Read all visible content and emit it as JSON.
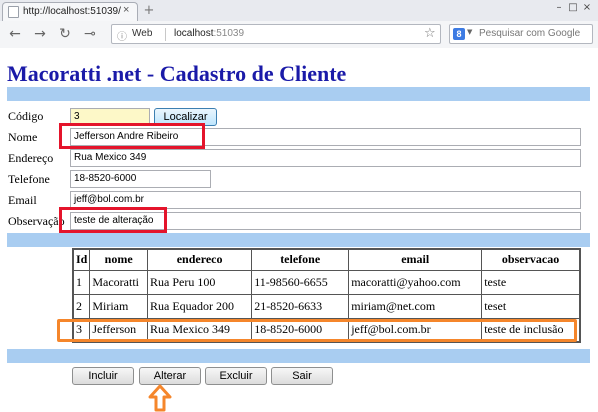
{
  "browser": {
    "tab_title": "http://localhost:51039/",
    "tab_close": "×",
    "new_tab": "+",
    "win_controls": [
      "–",
      "□",
      "×"
    ],
    "back_icon": "←",
    "forward_icon": "→",
    "reload_icon": "↻",
    "key_icon": "⊸",
    "omnibox_info_icon": "ⓘ",
    "omnibox_web": "Web",
    "url_host": "localhost",
    "url_port": ":51039",
    "star_icon": "☆",
    "search_engine_letter": "8",
    "search_drop_icon": "▼",
    "search_placeholder": "Pesquisar com Google"
  },
  "page": {
    "title": "Macoratti .net - Cadastro de Cliente"
  },
  "form": {
    "codigo": {
      "label": "Código",
      "value": "3"
    },
    "localizar_label": "Localizar",
    "nome": {
      "label": "Nome",
      "value": "Jefferson Andre Ribeiro"
    },
    "endereco": {
      "label": "Endereço",
      "value": "Rua Mexico 349"
    },
    "telefone": {
      "label": "Telefone",
      "value": "18-8520-6000"
    },
    "email": {
      "label": "Email",
      "value": "jeff@bol.com.br"
    },
    "observacao": {
      "label": "Observação",
      "value": "teste de alteração"
    }
  },
  "table": {
    "headers": [
      "Id",
      "nome",
      "endereco",
      "telefone",
      "email",
      "observacao"
    ],
    "rows": [
      [
        "1",
        "Macoratti",
        "Rua Peru 100",
        "11-98560-6655",
        "macoratti@yahoo.com",
        "teste"
      ],
      [
        "2",
        "Miriam",
        "Rua Equador 200",
        "21-8520-6633",
        "miriam@net.com",
        "teset"
      ],
      [
        "3",
        "Jefferson",
        "Rua Mexico 349",
        "18-8520-6000",
        "jeff@bol.com.br",
        "teste de inclusão"
      ]
    ]
  },
  "buttons": {
    "incluir": "Incluir",
    "alterar": "Alterar",
    "excluir": "Excluir",
    "sair": "Sair"
  },
  "colors": {
    "title": "#1a1aa8",
    "band": "#a9cdf1",
    "highlight_red": "#e4142b",
    "highlight_orange": "#f5862b"
  }
}
